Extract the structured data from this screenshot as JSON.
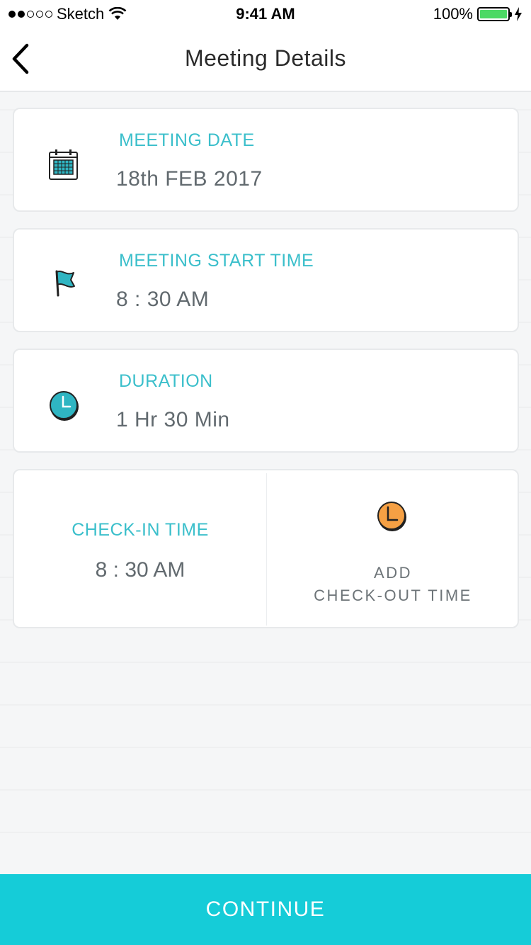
{
  "status_bar": {
    "carrier": "Sketch",
    "time": "9:41 AM",
    "battery": "100%"
  },
  "nav": {
    "title": "Meeting Details",
    "back_icon": "chevron-left-icon"
  },
  "cards": {
    "meeting_date": {
      "label": "MEETING DATE",
      "value": "18th FEB 2017",
      "icon": "calendar-icon"
    },
    "start_time": {
      "label": "MEETING START TIME",
      "value": "8 : 30 AM",
      "icon": "flag-icon"
    },
    "duration": {
      "label": "DURATION",
      "value": "1 Hr 30 Min",
      "icon": "clock-icon"
    }
  },
  "checkin": {
    "label": "CHECK-IN TIME",
    "value": "8 : 30 AM"
  },
  "checkout": {
    "line1": "ADD",
    "line2": "CHECK-OUT TIME",
    "icon": "clock-icon"
  },
  "continue_label": "CONTINUE",
  "colors": {
    "accent": "#15ccd8",
    "label_teal": "#3bbfcb",
    "clock_orange": "#f5a044"
  }
}
